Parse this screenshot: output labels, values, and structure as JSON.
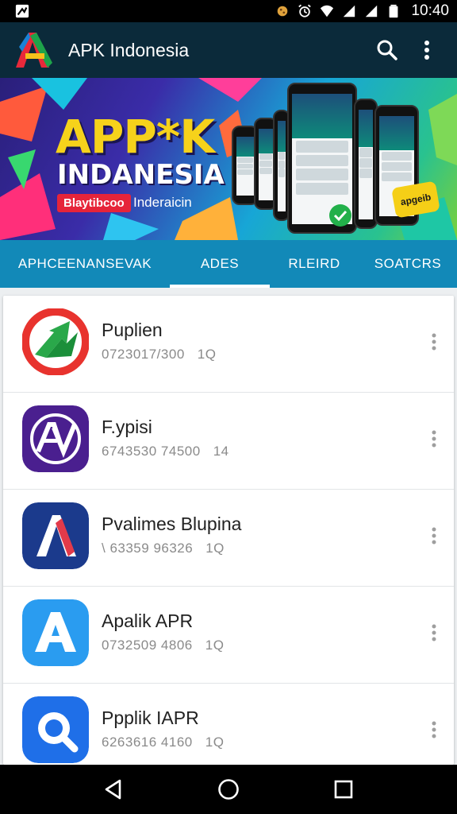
{
  "status_bar": {
    "time": "10:40",
    "icons": [
      "app-notification-icon",
      "cookie-notification-icon",
      "alarm-icon",
      "wifi-icon",
      "signal-icon",
      "signal-icon",
      "battery-icon"
    ]
  },
  "app_bar": {
    "title": "APK Indonesia",
    "logo": "apk-logo-icon",
    "actions": [
      "search-icon",
      "more-vert-icon"
    ]
  },
  "banner": {
    "title_line1": "APP*K",
    "title_line2": "INDANESIA",
    "chip": "Blaytibcoo",
    "subtitle": "Inderaicin",
    "badge": "apgeib",
    "colors": {
      "title": "#f6d21b",
      "chip": "#e6243a"
    }
  },
  "tabs": {
    "items": [
      {
        "label": "APHCEENANSEVAK",
        "selected": false
      },
      {
        "label": "ADES",
        "selected": true
      },
      {
        "label": "RLEIRD",
        "selected": false
      },
      {
        "label": "SOATCRS",
        "selected": false
      }
    ],
    "colors": {
      "background": "#1289b8",
      "indicator": "#ffffff"
    }
  },
  "apps": [
    {
      "name": "Puplien",
      "meta": "0723017/300",
      "count": "1Q",
      "icon": "green-arrow-logo-icon"
    },
    {
      "name": "F.ypisi",
      "meta": "6743530 74500",
      "count": "14",
      "icon": "purple-av-logo-icon"
    },
    {
      "name": "Pvalimes Blupina",
      "meta": "\\ 63359 96326",
      "count": "1Q",
      "icon": "navy-a-logo-icon"
    },
    {
      "name": "Apalik APR",
      "meta": "0732509 4806",
      "count": "1Q",
      "icon": "blue-a-logo-icon"
    },
    {
      "name": "Ppplik IAPR",
      "meta": "6263616 4160",
      "count": "1Q",
      "icon": "magnifier-logo-icon"
    }
  ],
  "nav_bar": {
    "buttons": [
      "back-icon",
      "home-icon",
      "recents-icon"
    ]
  }
}
